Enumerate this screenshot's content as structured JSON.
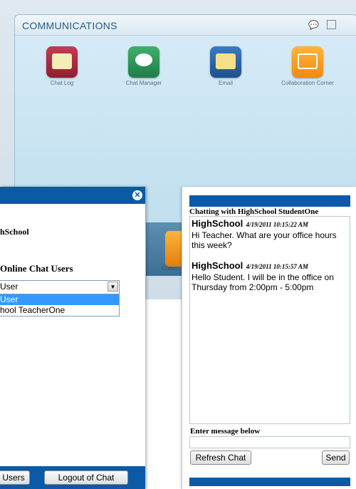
{
  "communications": {
    "title": "COMMUNICATIONS",
    "apps": [
      {
        "label": "Chat Log",
        "icon": "chat-log-icon"
      },
      {
        "label": "Chat Manager",
        "icon": "chat-bubbles-icon"
      },
      {
        "label": "Email",
        "icon": "envelope-icon"
      },
      {
        "label": "Collaboration Corner",
        "icon": "collaboration-icon"
      }
    ],
    "dock_label": "Comm"
  },
  "chat_manager": {
    "username": "hSchool",
    "online_header": "Online Chat Users",
    "select_value": "User",
    "options": [
      "User",
      "hool TeacherOne"
    ],
    "users_button": "Users",
    "logout_button": "Logout of Chat",
    "close_icon": "close-icon"
  },
  "chat_window": {
    "header": "Chatting with HighSchool StudentOne",
    "messages": [
      {
        "sender": "HighSchool",
        "timestamp": "4/19/2011 10:15:22 AM",
        "text": "Hi Teacher. What are your office hours this week?"
      },
      {
        "sender": "HighSchool",
        "timestamp": "4/19/2011 10:15:57 AM",
        "text": "Hello Student. I will be in the office on Thursday from 2:00pm - 5:00pm"
      }
    ],
    "enter_label": "Enter message below",
    "input_value": "",
    "refresh_button": "Refresh Chat",
    "send_button": "Send"
  },
  "colors": {
    "titlebar_blue": "#0a5aa8",
    "panel_bg": "#c6e2f1",
    "selection_blue": "#3399ff"
  }
}
